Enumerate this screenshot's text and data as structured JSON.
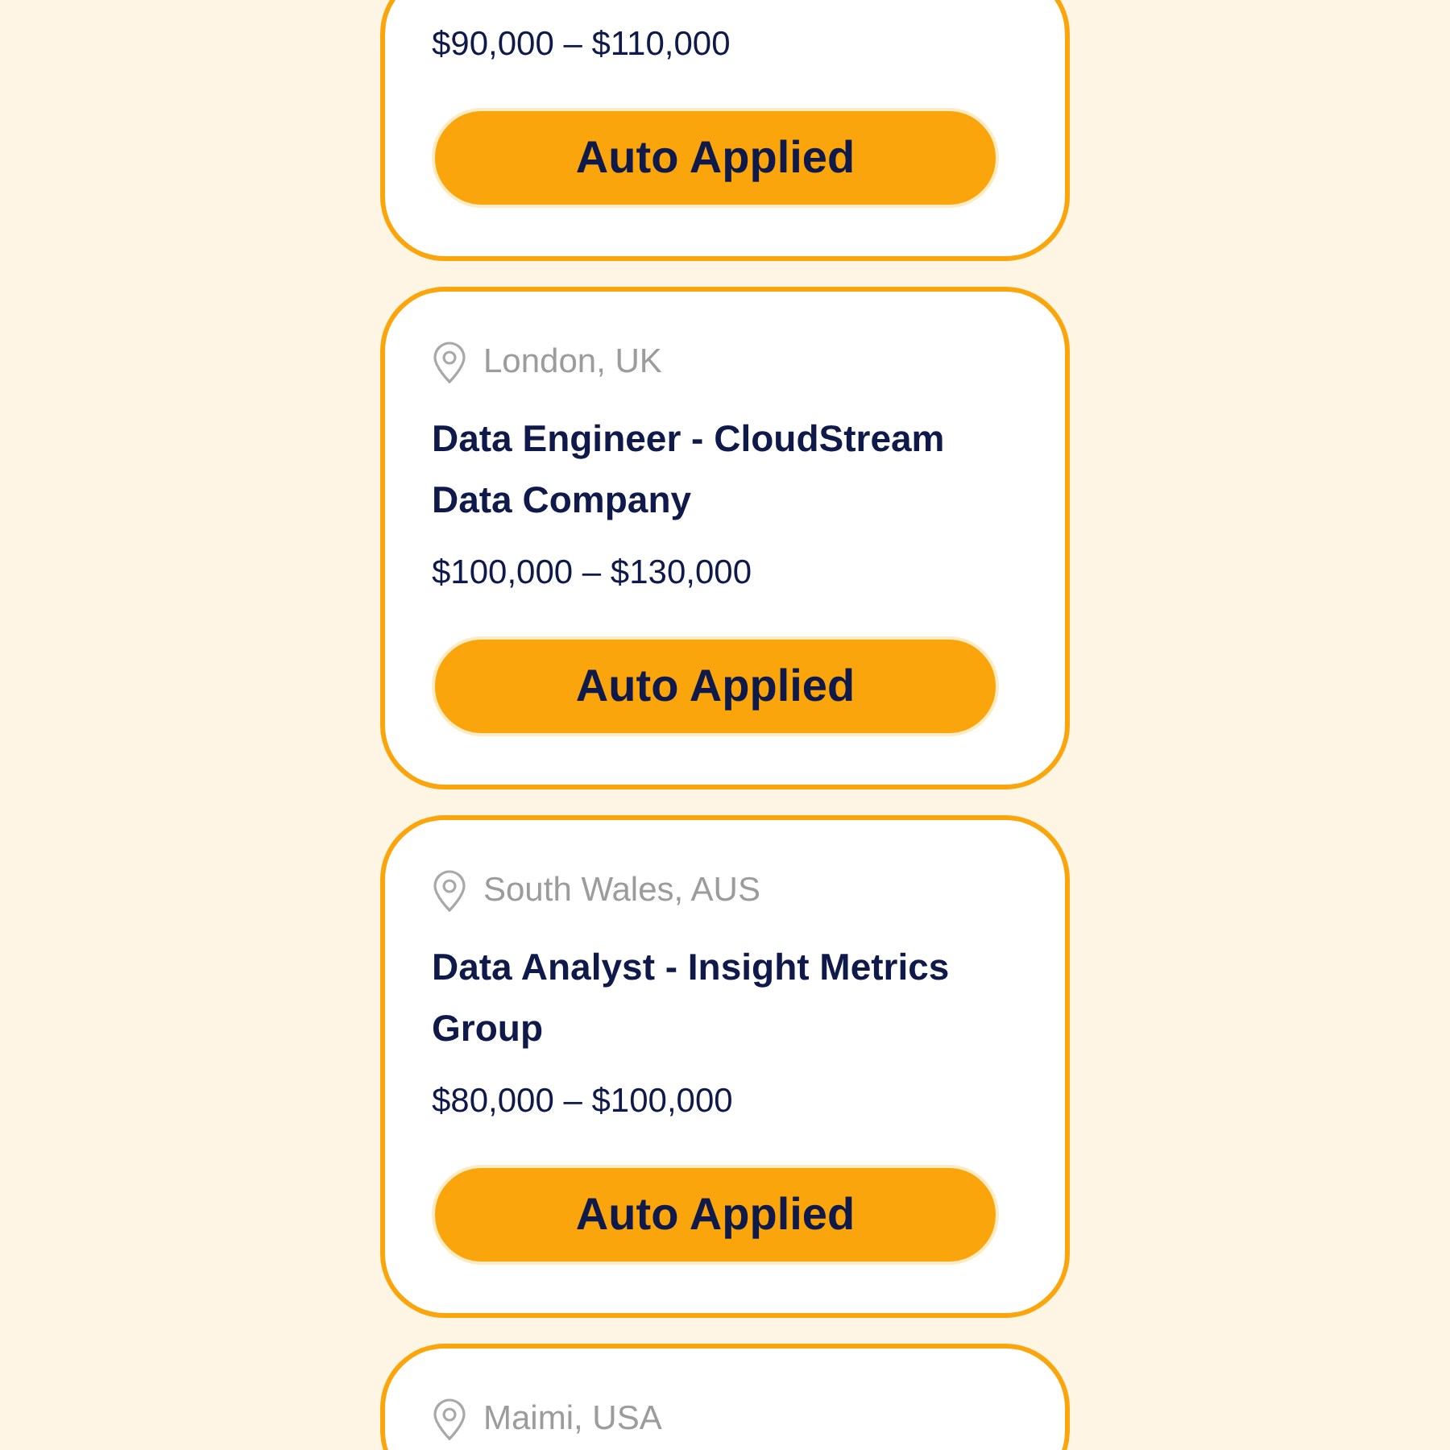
{
  "jobs": [
    {
      "salary": "$90,000 – $110,000",
      "button": "Auto Applied"
    },
    {
      "location": "London, UK",
      "title": "Data Engineer - CloudStream Data Company",
      "salary": "$100,000 – $130,000",
      "button": "Auto Applied"
    },
    {
      "location": "South Wales, AUS",
      "title": "Data Analyst - Insight Metrics Group",
      "salary": "$80,000 – $100,000",
      "button": "Auto Applied"
    },
    {
      "location": "Maimi, USA"
    }
  ]
}
